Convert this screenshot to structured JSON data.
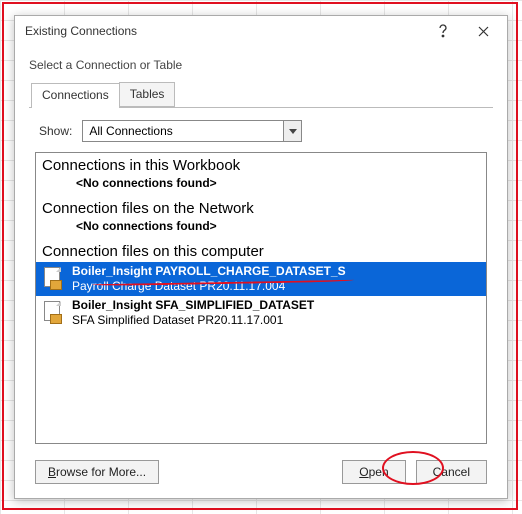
{
  "window": {
    "title": "Existing Connections"
  },
  "instruction": "Select a Connection or Table",
  "tabs": {
    "active": "Connections",
    "inactive": "Tables"
  },
  "show": {
    "label": "Show:",
    "value": "All Connections"
  },
  "groups": {
    "workbook": {
      "title": "Connections in this Workbook",
      "empty": "<No connections found>"
    },
    "network": {
      "title": "Connection files on the Network",
      "empty": "<No connections found>"
    },
    "computer": {
      "title": "Connection files on this computer"
    }
  },
  "items": {
    "selected": {
      "name": "Boiler_Insight PAYROLL_CHARGE_DATASET_S",
      "desc": "Payroll Charge Dataset PR20.11.17.004"
    },
    "other": {
      "name": "Boiler_Insight SFA_SIMPLIFIED_DATASET",
      "desc": "SFA Simplified Dataset PR20.11.17.001"
    }
  },
  "buttons": {
    "browse_prefix": "B",
    "browse_rest": "rowse for More...",
    "open_prefix": "O",
    "open_rest": "pen",
    "cancel": "Cancel"
  }
}
